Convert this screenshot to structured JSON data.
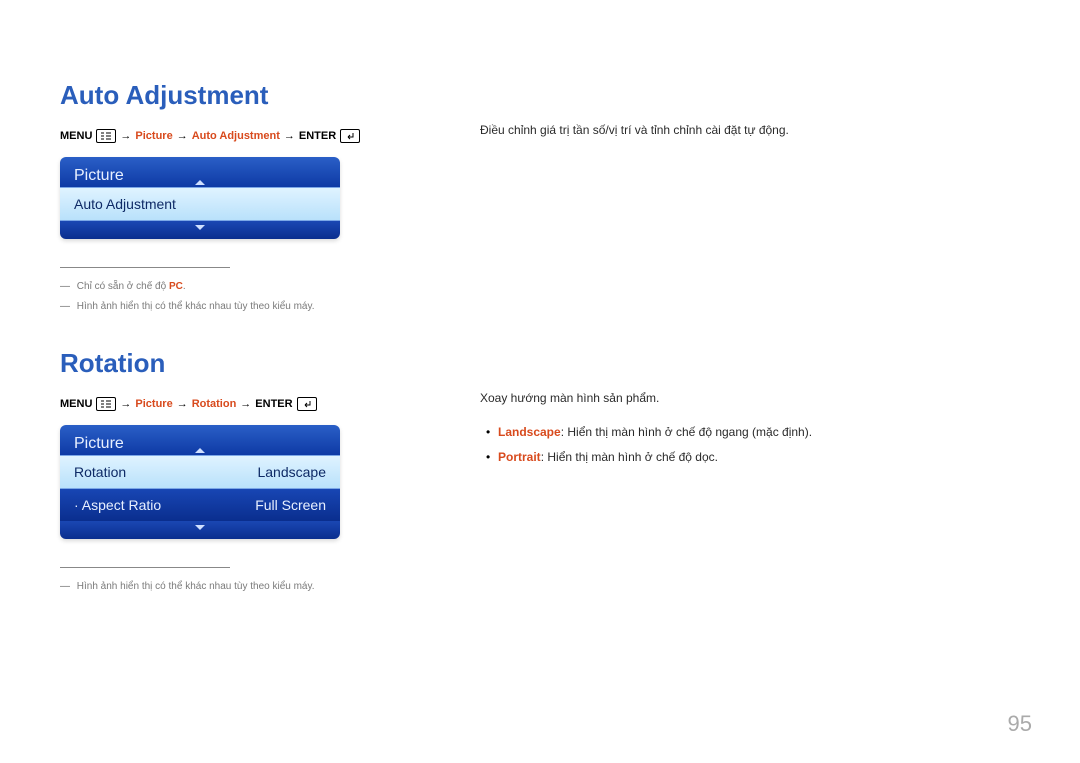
{
  "page_number": "95",
  "section1": {
    "title": "Auto Adjustment",
    "path": {
      "menu": "MENU",
      "seg1": "Picture",
      "seg2": "Auto Adjustment",
      "enter": "ENTER"
    },
    "osd": {
      "header": "Picture",
      "row1_label": "Auto Adjustment"
    },
    "footnote1_prefix": "Chỉ có sẵn ở chế độ ",
    "footnote1_key": "PC",
    "footnote1_suffix": ".",
    "footnote2": "Hình ảnh hiển thị có thể khác nhau tùy theo kiểu máy.",
    "description": "Điều chỉnh giá trị tần số/vị trí và tỉnh chỉnh cài đặt tự động."
  },
  "section2": {
    "title": "Rotation",
    "path": {
      "menu": "MENU",
      "seg1": "Picture",
      "seg2": "Rotation",
      "enter": "ENTER"
    },
    "osd": {
      "header": "Picture",
      "row1_label": "Rotation",
      "row1_value": "Landscape",
      "row2_label": "· Aspect Ratio",
      "row2_value": "Full Screen"
    },
    "footnote": "Hình ảnh hiển thị có thể khác nhau tùy theo kiểu máy.",
    "description": "Xoay hướng màn hình sản phẩm.",
    "bullets": [
      {
        "key": "Landscape",
        "text": ": Hiển thị màn hình ở chế độ ngang (mặc định)."
      },
      {
        "key": "Portrait",
        "text": ": Hiển thị màn hình ở chế độ dọc."
      }
    ]
  }
}
